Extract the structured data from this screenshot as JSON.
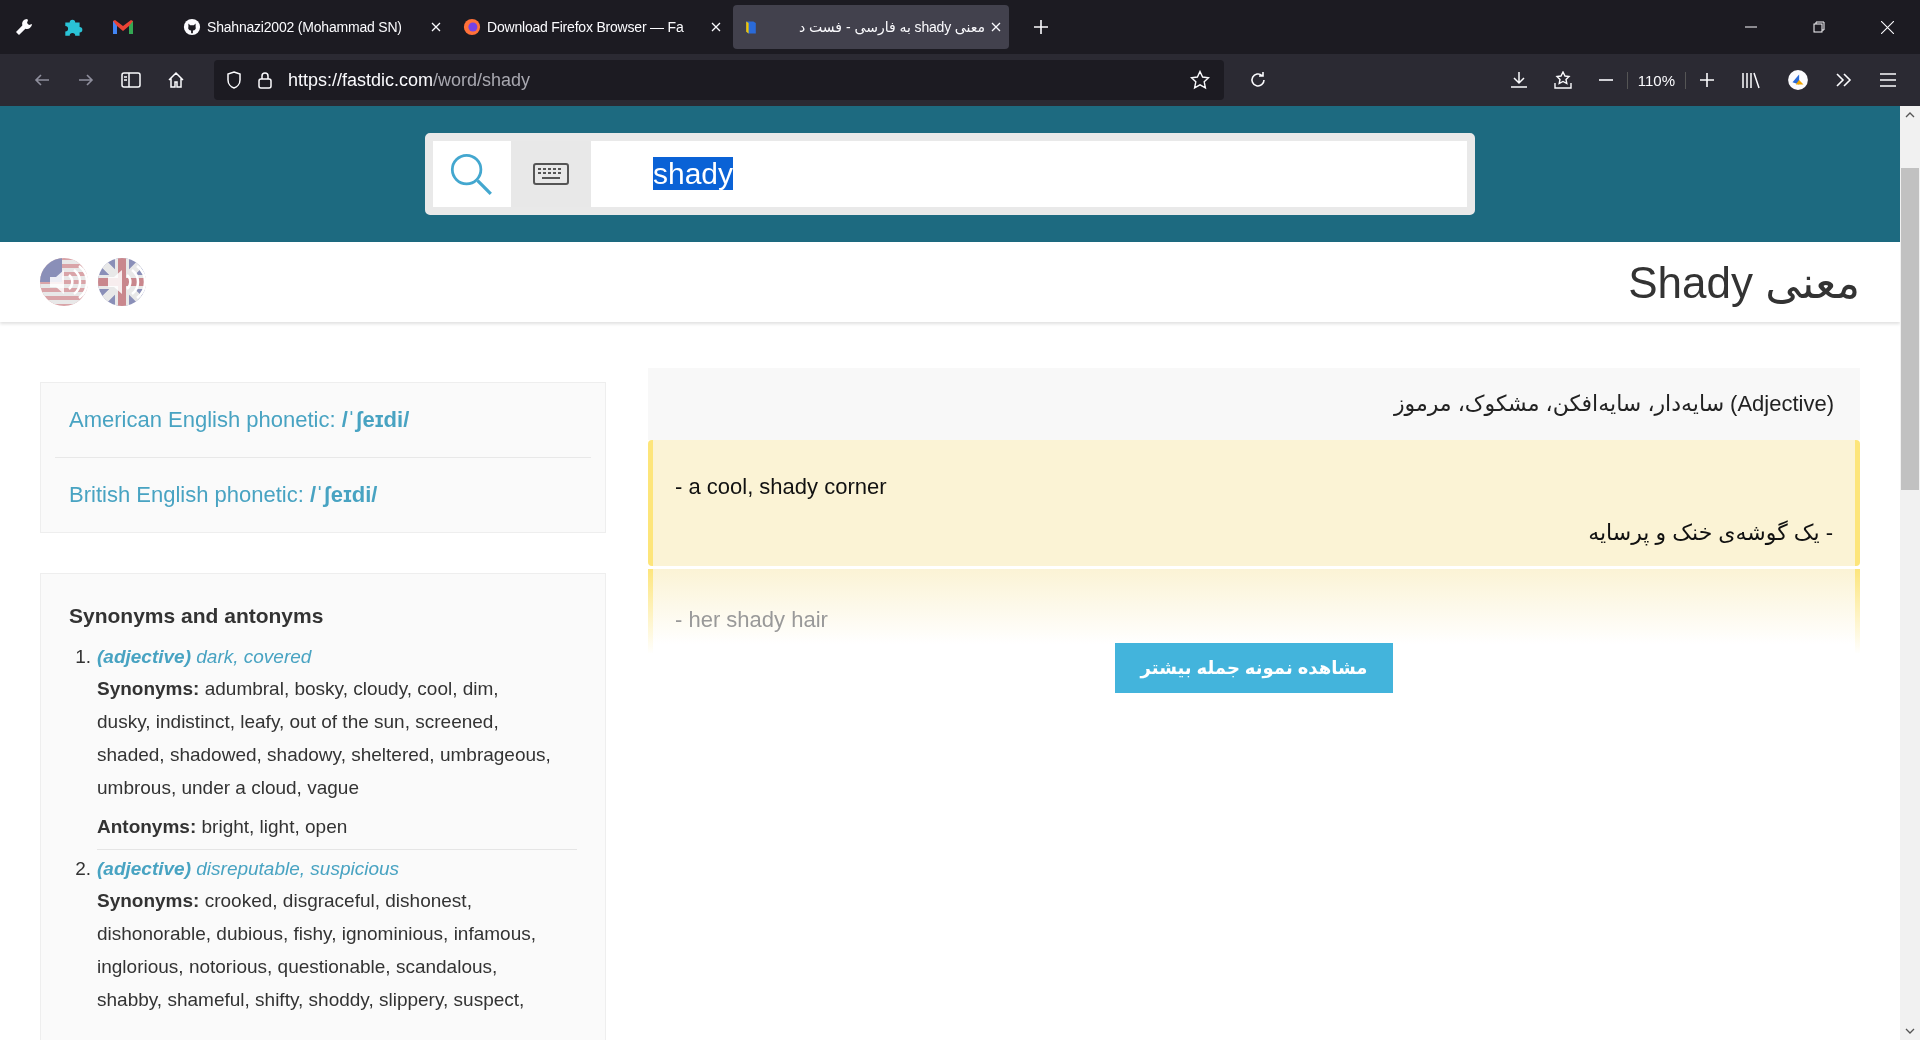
{
  "browser": {
    "tabs": [
      {
        "kind": "github",
        "title": "Shahnazi2002 (Mohammad SN)",
        "selected": false
      },
      {
        "kind": "firefox",
        "title": "Download Firefox Browser — Fa",
        "selected": false
      },
      {
        "kind": "dictionary",
        "title": "معنی shady به فارسی - فست د",
        "selected": true
      }
    ],
    "url_host": "https://fastdic.com",
    "url_path": "/word/shady",
    "zoom": "110%"
  },
  "search": {
    "value": "shady"
  },
  "heading": "معنی Shady",
  "pronunciations": [
    {
      "kind": "us"
    },
    {
      "kind": "uk"
    }
  ],
  "phonetics": [
    {
      "text": "American English phonetic: **/ˈʃeɪdi/**"
    },
    {
      "text": "British English phonetic: **/ˈʃeɪdi/**"
    }
  ],
  "synonyms": {
    "title": "Synonyms and antonyms",
    "senses": [
      {
        "number": "1.",
        "head": "**(adjective)** dark, covered",
        "lines": [
          "**Synonyms:** adumbral, bosky, cloudy, cool, dim, dusky, indistinct, leafy, out of the sun, screened, shaded, shadowed, shadowy, sheltered, umbrageous, umbrous, under a cloud, vague",
          "**Antonyms:** bright, light, open"
        ]
      },
      {
        "number": "2.",
        "head": "**(adjective)** disreputable, suspicious",
        "lines": [
          "**Synonyms:** crooked, disgraceful, dishonest, dishonorable, dubious, fishy, ignominious, infamous, inglorious, notorious, questionable, scandalous, shabby, shameful, shifty, shoddy, slippery, suspect,"
        ]
      }
    ]
  },
  "meaning": {
    "pos": "(Adjective)",
    "text": "سایه‌دار، سایه‌افکن، مشکوک، مرموز"
  },
  "examples": [
    {
      "en": "- a cool, shady corner",
      "fa": "- یک گوشه‌ی خنک و پرسایه",
      "faded": false
    },
    {
      "en": "- her shady hair",
      "faded": true
    }
  ],
  "more_button": "مشاهده نمونه جمله بیشتر"
}
